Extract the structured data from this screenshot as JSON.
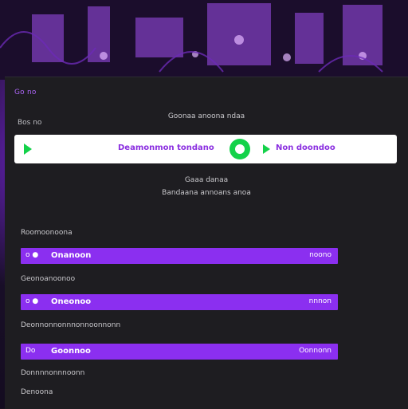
{
  "panel": {
    "header": "Go no",
    "caption": "Bos no",
    "heading": "Goonaa anoona ndaa",
    "player": {
      "track_left": "Deamonmon tondano",
      "track_right": "Non doondoo",
      "play_left_icon": "play-icon",
      "center_icon": "record-button-icon",
      "play_right_icon": "play-icon"
    },
    "subtext_1": "Gaaa danaa",
    "subtext_2": "Bandaana annoans anoa",
    "sections": [
      {
        "label": "Roomoonoona",
        "row": {
          "icon_text": "o ●",
          "title": "Onanoon",
          "right": "noono"
        }
      },
      {
        "label": "Geonoanoonoo",
        "row": {
          "icon_text": "o ●",
          "title": "Oneonoo",
          "right": "nnnon"
        }
      },
      {
        "label": "Deonnonnonnnonnoonnonn",
        "row": {
          "icon_text": "Do",
          "title": "Goonnoo",
          "right": "Oonnonn"
        }
      }
    ],
    "footer_1": "Donnnnonnnoonn",
    "footer_2": "Denoona"
  },
  "colors": {
    "accent": "#8b2ff0",
    "play_green": "#14d24a",
    "panel_bg": "#1e1d21"
  }
}
